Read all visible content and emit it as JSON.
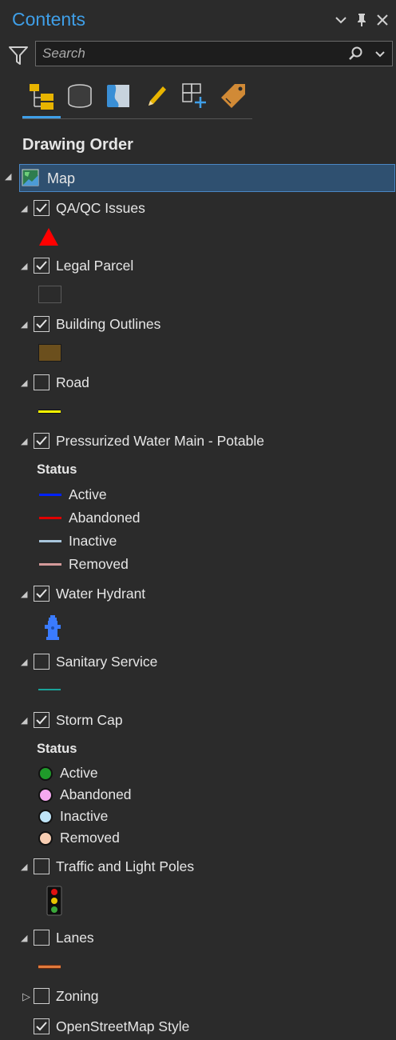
{
  "panel": {
    "title": "Contents",
    "icons": [
      "chevron-down-icon",
      "pin-icon",
      "close-icon"
    ]
  },
  "search": {
    "placeholder": "Search"
  },
  "toolbar": {
    "icons": [
      "drawing-order-icon",
      "data-source-icon",
      "selection-icon",
      "editing-icon",
      "snapping-icon",
      "labeling-icon"
    ]
  },
  "section": {
    "heading": "Drawing Order"
  },
  "map": {
    "label": "Map"
  },
  "layers": {
    "qaqc": {
      "label": "QA/QC Issues",
      "checked": true,
      "color": "#ff0000"
    },
    "parcel": {
      "label": "Legal Parcel",
      "checked": true
    },
    "buildings": {
      "label": "Building Outlines",
      "checked": true,
      "color": "#6b4f1d"
    },
    "road": {
      "label": "Road",
      "checked": false,
      "color": "#ffff00"
    },
    "water": {
      "label": "Pressurized Water Main - Potable",
      "checked": true,
      "status_heading": "Status",
      "legend": [
        {
          "label": "Active",
          "color": "#0022ff"
        },
        {
          "label": "Abandoned",
          "color": "#e00000"
        },
        {
          "label": "Inactive",
          "color": "#a9c6dc"
        },
        {
          "label": "Removed",
          "color": "#d49a9a"
        }
      ]
    },
    "hydrant": {
      "label": "Water Hydrant",
      "checked": true,
      "color": "#3a7bff"
    },
    "sanitary": {
      "label": "Sanitary Service",
      "checked": false,
      "color": "#1aa39a"
    },
    "storm": {
      "label": "Storm Cap",
      "checked": true,
      "status_heading": "Status",
      "legend": [
        {
          "label": "Active",
          "color": "#1f9a2a"
        },
        {
          "label": "Abandoned",
          "color": "#f5a9f0"
        },
        {
          "label": "Inactive",
          "color": "#bfe4f7"
        },
        {
          "label": "Removed",
          "color": "#f7cdb2"
        }
      ]
    },
    "poles": {
      "label": "Traffic and Light Poles",
      "checked": false
    },
    "lanes": {
      "label": "Lanes",
      "checked": false,
      "color": "#e07a3c"
    },
    "zoning": {
      "label": "Zoning",
      "checked": false
    },
    "osm": {
      "label": "OpenStreetMap Style",
      "checked": true
    }
  }
}
